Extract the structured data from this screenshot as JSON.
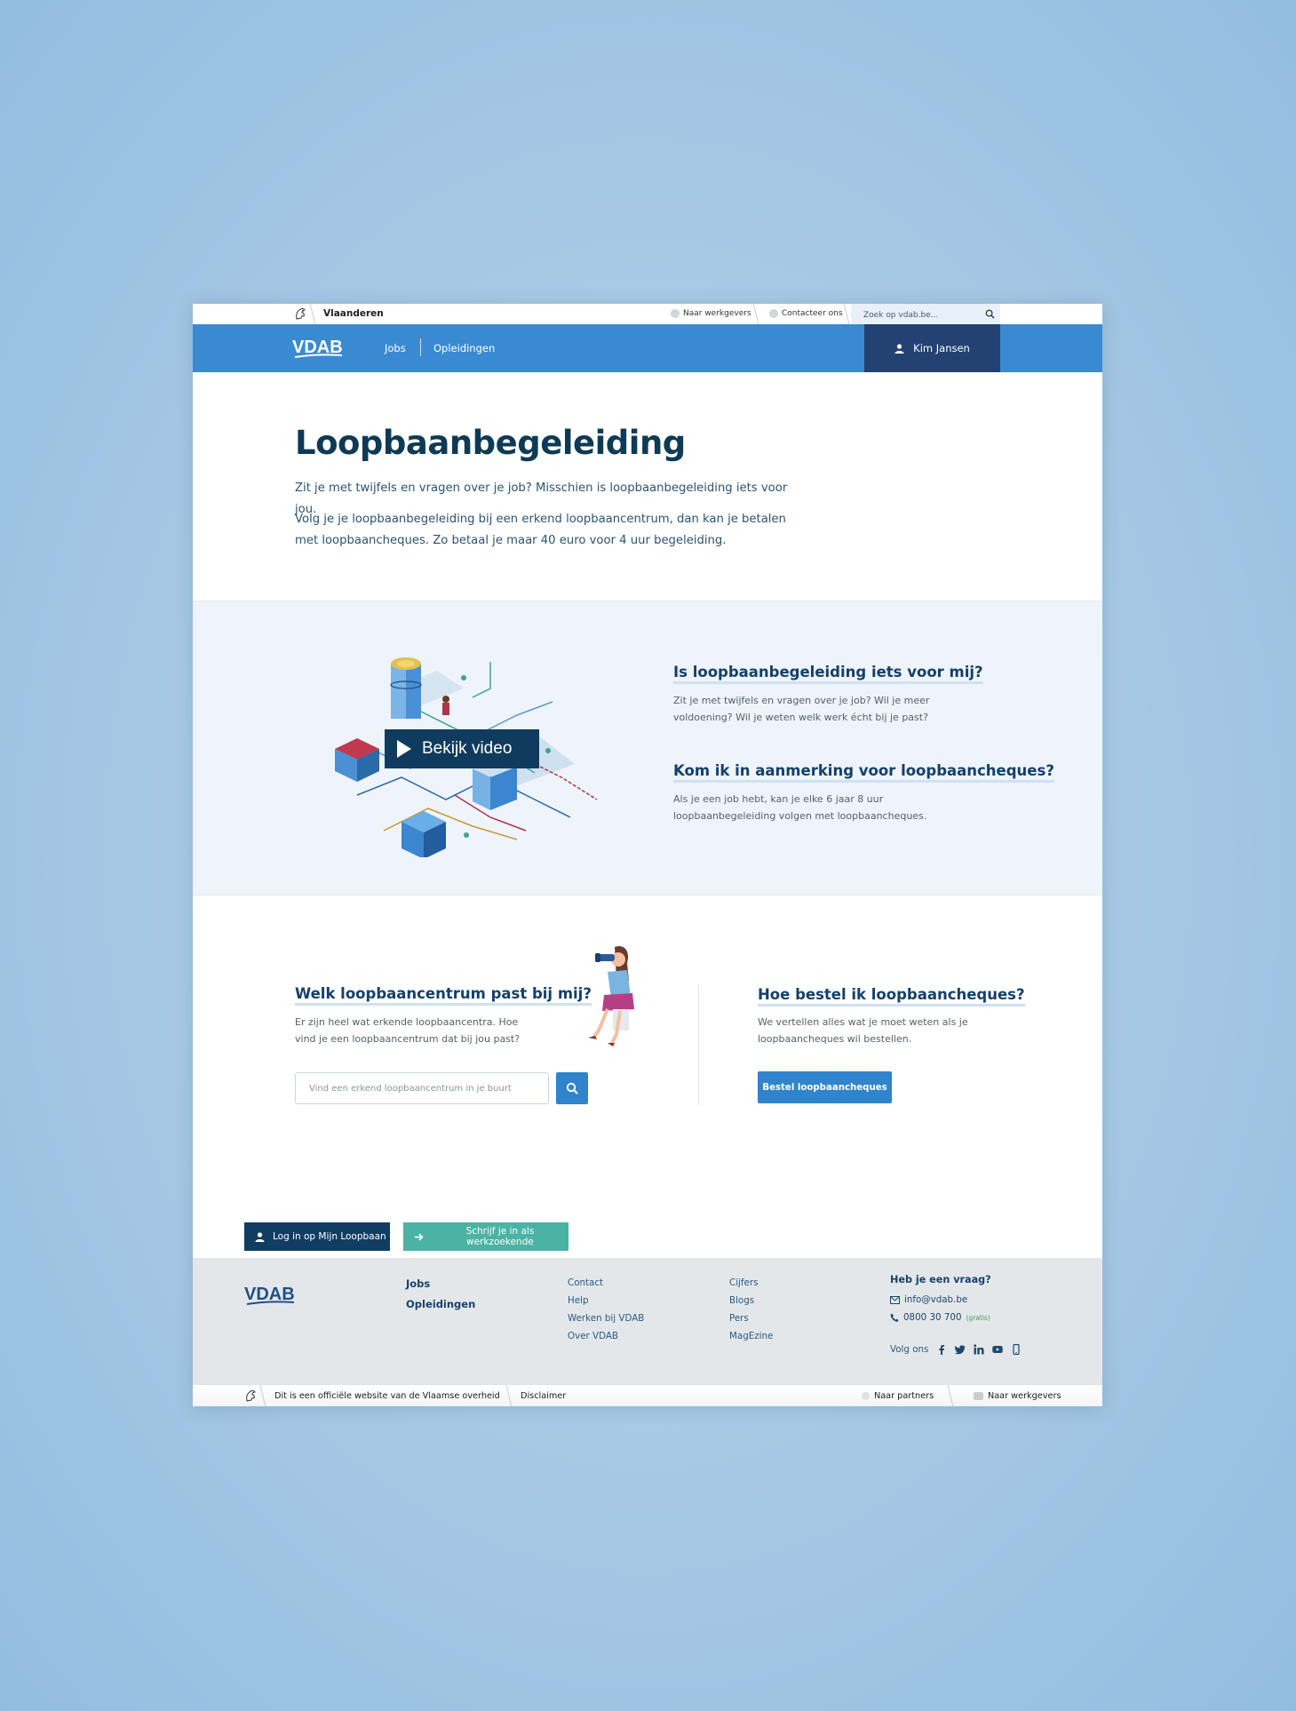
{
  "topbar": {
    "brand": "Vlaanderen",
    "employers_link": "Naar werkgevers",
    "contact_link": "Contacteer ons",
    "search_placeholder": "Zoek op vdab.be..."
  },
  "nav": {
    "logo_text": "VDAB",
    "items": [
      "Jobs",
      "Opleidingen"
    ],
    "user_name": "Kim Jansen"
  },
  "intro": {
    "title": "Loopbaanbegeleiding",
    "paragraph1": "Zit je met twijfels en vragen over je job? Misschien is loopbaanbegeleiding iets voor jou.",
    "paragraph2": "Volg je je loopbaanbegeleiding bij een erkend loopbaancentrum, dan kan je betalen met loopbaancheques. Zo betaal je maar 40 euro voor 4 uur begeleiding."
  },
  "feature": {
    "video_button": "Bekijk video",
    "q1_title": "Is loopbaanbegeleiding iets voor mij?",
    "q1_text": "Zit je met twijfels en vragen over je job? Wil je meer voldoening? Wil je weten welk werk écht bij je past?",
    "q2_title": "Kom ik in aanmerking voor loopbaancheques?",
    "q2_text": "Als je een job hebt, kan je elke 6 jaar 8 uur loopbaanbegeleiding volgen met loopbaancheques."
  },
  "centres": {
    "title": "Welk loopbaancentrum past bij mij?",
    "text": "Er zijn heel wat erkende loopbaancentra. Hoe vind je een loopbaancentrum dat bij jou past?",
    "search_placeholder": "Vind een erkend loopbaancentrum in je buurt"
  },
  "order": {
    "title": "Hoe bestel ik loopbaancheques?",
    "text": "We vertellen alles wat je moet weten als je loopbaancheques wil bestellen.",
    "button": "Bestel loopbaancheques"
  },
  "cta": {
    "login": "Log in op Mijn Loopbaan",
    "register": "Schrijf je in als werkzoekende"
  },
  "footer": {
    "logo_text": "VDAB",
    "main_links": [
      "Jobs",
      "Opleidingen"
    ],
    "col2": [
      "Contact",
      "Help",
      "Werken bij VDAB",
      "Over VDAB"
    ],
    "col3": [
      "Cijfers",
      "Blogs",
      "Pers",
      "MagEzine"
    ],
    "help_title": "Heb je een vraag?",
    "email": "info@vdab.be",
    "phone": "0800 30 700",
    "phone_note": "(gratis)",
    "follow": "Volg ons",
    "social_icons": [
      "facebook-icon",
      "twitter-icon",
      "linkedin-icon",
      "youtube-icon",
      "mobile-icon"
    ]
  },
  "bottombar": {
    "official": "Dit is een officiële website van de Vlaamse overheid",
    "disclaimer": "Disclaimer",
    "partners": "Naar partners",
    "employers": "Naar werkgevers"
  },
  "colors": {
    "nav_blue": "#3a8ad1",
    "dark_navy": "#234273",
    "heading": "#0e3a55",
    "accent_teal": "#4bb3a4",
    "button_blue": "#2f84cc"
  }
}
